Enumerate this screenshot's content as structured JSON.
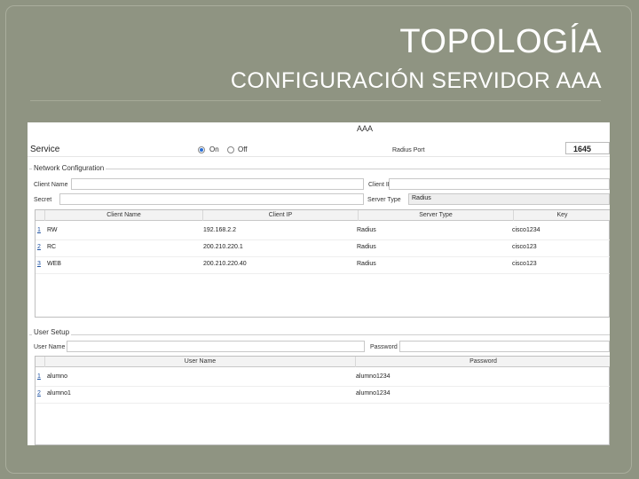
{
  "slide": {
    "title": "TOPOLOGÍA",
    "subtitle": "CONFIGURACIÓN SERVIDOR AAA"
  },
  "window": {
    "title": "AAA"
  },
  "service": {
    "label": "Service",
    "on_label": "On",
    "off_label": "Off",
    "selected": "On",
    "radius_port_label": "Radius Port",
    "radius_port_value": "1645"
  },
  "network_config": {
    "group_label": "Network Configuration",
    "client_name_label": "Client Name",
    "client_name_value": "",
    "client_ip_label": "Client IP",
    "client_ip_value": "",
    "secret_label": "Secret",
    "secret_value": "",
    "server_type_label": "Server Type",
    "server_type_value": "Radius",
    "columns": [
      "Client Name",
      "Client IP",
      "Server Type",
      "Key"
    ],
    "rows": [
      {
        "num": "1",
        "client_name": "RW",
        "client_ip": "192.168.2.2",
        "server_type": "Radius",
        "key": "cisco1234"
      },
      {
        "num": "2",
        "client_name": "RC",
        "client_ip": "200.210.220.1",
        "server_type": "Radius",
        "key": "cisco123"
      },
      {
        "num": "3",
        "client_name": "WEB",
        "client_ip": "200.210.220.40",
        "server_type": "Radius",
        "key": "cisco123"
      }
    ]
  },
  "user_setup": {
    "group_label": "User Setup",
    "user_name_label": "User Name",
    "user_name_value": "",
    "password_label": "Password",
    "password_value": "",
    "columns": [
      "User Name",
      "Password"
    ],
    "rows": [
      {
        "num": "1",
        "user_name": "alumno",
        "password": "alumno1234"
      },
      {
        "num": "2",
        "user_name": "alumno1",
        "password": "alumno1234"
      }
    ]
  }
}
